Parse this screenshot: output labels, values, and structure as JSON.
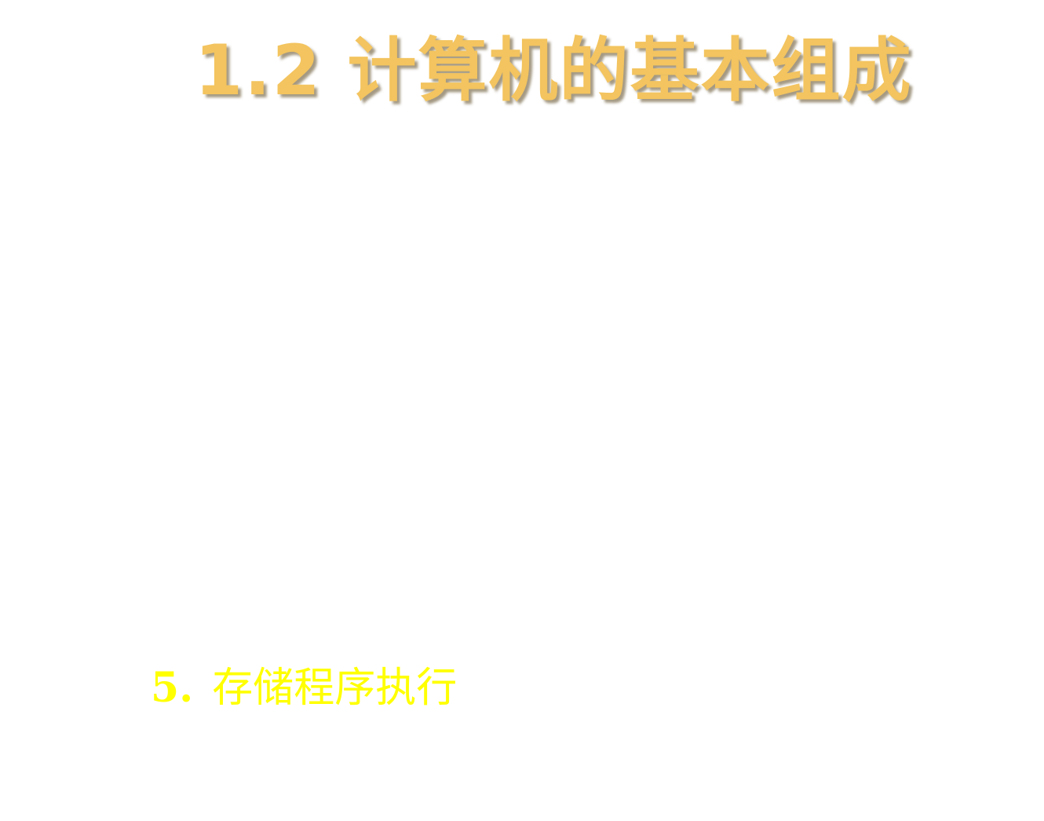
{
  "slide": {
    "title": "1.2 计算机的基本组成",
    "item": {
      "number": "5.",
      "text": "存储程序执行"
    }
  }
}
